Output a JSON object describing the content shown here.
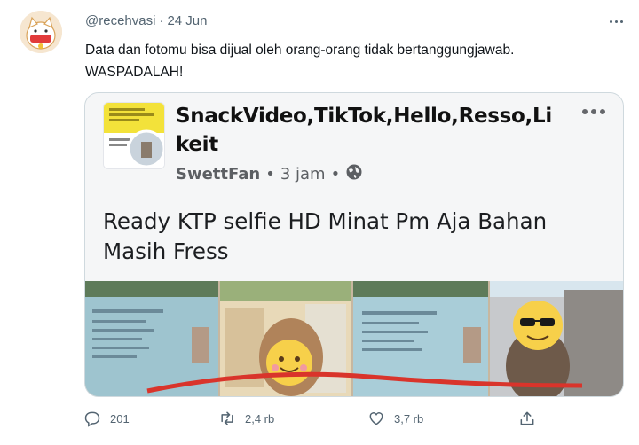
{
  "tweet": {
    "handle": "@recehvasi",
    "separator": "·",
    "date": "24 Jun",
    "text_line1": "Data dan fotomu bisa dijual oleh orang-orang tidak bertanggungjawab.",
    "text_line2": "WASPADALAH!"
  },
  "embedded_post": {
    "title_line1": "SnackVideo,TikTok,Hello,Resso,Li",
    "title_line2": "keit",
    "author": "SwettFan",
    "time": "3 jam",
    "meta_separator": "•",
    "body_line1": "Ready KTP selfie HD Minat Pm Aja Bahan",
    "body_line2": "Masih Fress"
  },
  "actions": {
    "reply_count": "201",
    "retweet_count": "2,4 rb",
    "like_count": "3,7 rb"
  },
  "colors": {
    "text_primary": "#0f1419",
    "text_secondary": "#536471",
    "border": "#cfd9de"
  },
  "icons": [
    "more-icon",
    "reply-icon",
    "retweet-icon",
    "like-icon",
    "share-icon",
    "globe-icon"
  ]
}
